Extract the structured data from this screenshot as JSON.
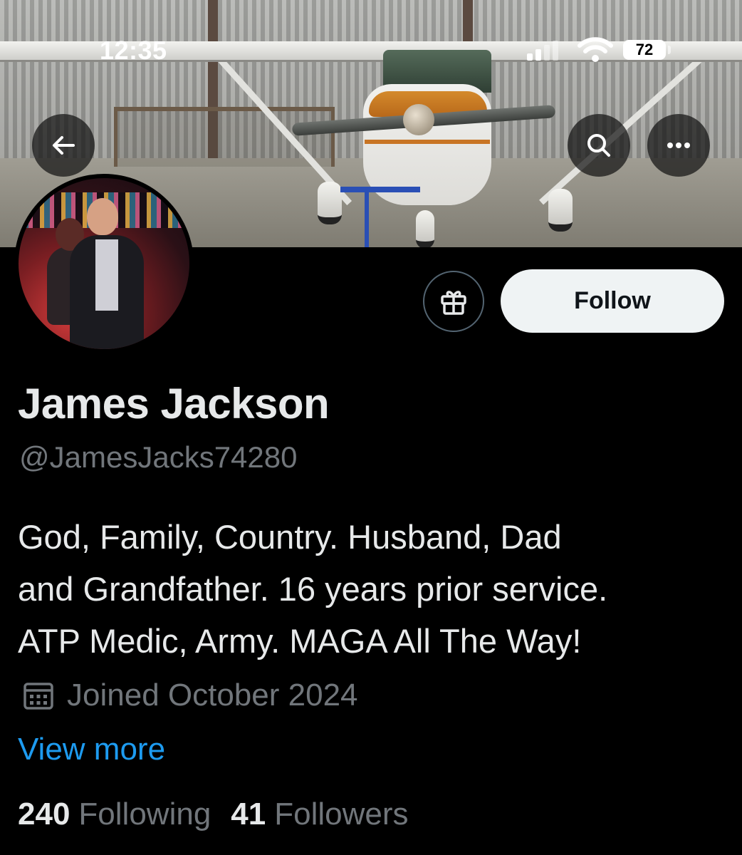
{
  "status_bar": {
    "time": "12:35",
    "battery_level": "72",
    "signal_bars": 2,
    "wifi": "connected"
  },
  "header": {
    "back_icon": "arrow-left-icon",
    "search_icon": "search-icon",
    "more_icon": "more-horizontal-icon"
  },
  "profile": {
    "display_name": "James Jackson",
    "handle": "@JamesJacks74280",
    "bio_lines": [
      "God, Family, Country. Husband, Dad",
      "and Grandfather. 16 years prior service.",
      "ATP Medic, Army. MAGA All The Way!"
    ],
    "joined": "Joined October 2024",
    "view_more": "View more",
    "following_count": "240",
    "following_label": "Following",
    "followers_count": "41",
    "followers_label": "Followers"
  },
  "actions": {
    "follow_label": "Follow",
    "gift_icon": "gift-icon"
  },
  "colors": {
    "background": "#000000",
    "primary_text": "#e7e9ea",
    "secondary_text": "#71767b",
    "link": "#1d9bf0",
    "follow_button_bg": "#eff3f4"
  }
}
